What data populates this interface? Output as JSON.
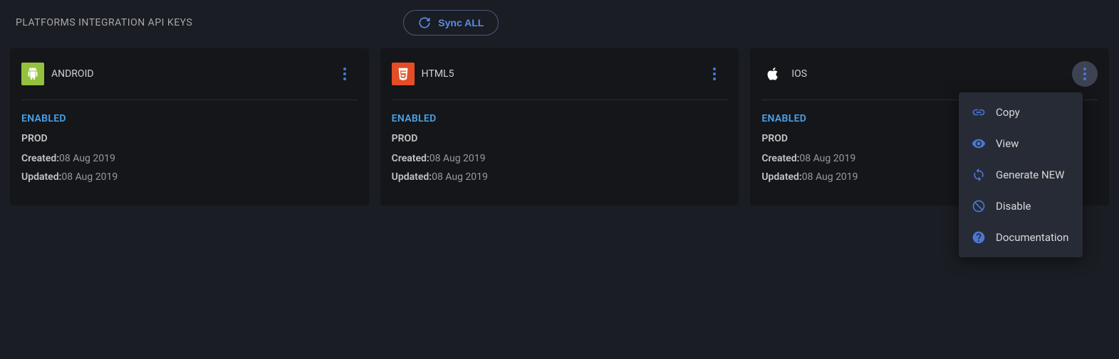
{
  "header": {
    "title": "PLATFORMS INTEGRATION API KEYS",
    "sync_label": "Sync ALL"
  },
  "platforms": [
    {
      "name": "ANDROID",
      "status": "ENABLED",
      "env": "PROD",
      "created_label": "Created:",
      "created_date": "08 Aug 2019",
      "updated_label": "Updated:",
      "updated_date": "08 Aug 2019"
    },
    {
      "name": "HTML5",
      "status": "ENABLED",
      "env": "PROD",
      "created_label": "Created:",
      "created_date": "08 Aug 2019",
      "updated_label": "Updated:",
      "updated_date": "08 Aug 2019"
    },
    {
      "name": "IOS",
      "status": "ENABLED",
      "env": "PROD",
      "created_label": "Created:",
      "created_date": "08 Aug 2019",
      "updated_label": "Updated:",
      "updated_date": "08 Aug 2019"
    }
  ],
  "menu": {
    "copy": "Copy",
    "view": "View",
    "generate": "Generate NEW",
    "disable": "Disable",
    "documentation": "Documentation"
  }
}
